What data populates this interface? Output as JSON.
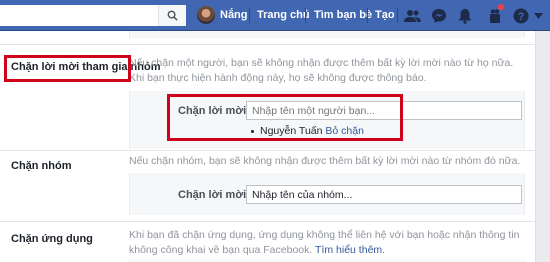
{
  "topbar": {
    "user_name": "Nắng",
    "nav": [
      "Trang chủ",
      "Tìm bạn bè",
      "Tạo"
    ],
    "icons": [
      "search-icon",
      "friends-icon",
      "messenger-icon",
      "notifications-icon",
      "quick-help-icon",
      "help-icon"
    ]
  },
  "sections": {
    "invites": {
      "title": "Chặn lời mời tham gia nhóm",
      "description": "Nếu chặn một người, bạn sẽ không nhận được thêm bất kỳ lời mời nào từ họ nữa. Khi bạn thực hiện hành động này, họ sẽ không được thông báo.",
      "label": "Chặn lời mời từ",
      "placeholder": "Nhập tên một người bạn...",
      "blocked_user": "Nguyễn Tuấn",
      "unblock": "Bỏ chặn"
    },
    "groups": {
      "title": "Chặn nhóm",
      "description": "Nếu chặn nhóm, bạn sẽ không nhận được thêm bất kỳ lời mời nào từ nhóm đó nữa.",
      "label": "Chặn lời mời từ",
      "value": "Nhập tên của nhóm..."
    },
    "apps": {
      "title": "Chặn ứng dụng",
      "description": "Khi bạn đã chặn ứng dụng, ứng dụng không thể liên hệ với bạn hoặc nhận thông tin không công khai về bạn qua Facebook.",
      "learn_more": "Tìm hiểu thêm."
    }
  },
  "colors": {
    "brand": "#4267b2",
    "highlight": "#d0021b",
    "link": "#365899"
  }
}
